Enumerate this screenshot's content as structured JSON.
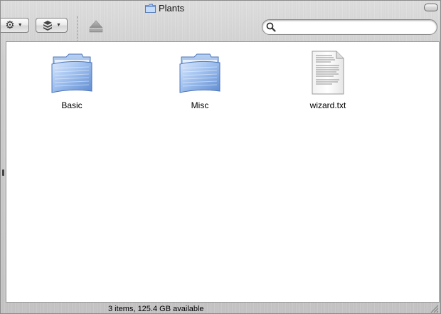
{
  "window": {
    "title": "Plants",
    "title_icon": "folder-icon"
  },
  "toolbar": {
    "action_icon": "gear-icon",
    "arrange_icon": "arrange-icon",
    "eject_icon": "eject-icon",
    "search": {
      "value": "",
      "placeholder": "",
      "icon": "magnifier-icon"
    }
  },
  "items": [
    {
      "label": "Basic",
      "icon": "folder-icon"
    },
    {
      "label": "Misc",
      "icon": "folder-icon"
    },
    {
      "label": "wizard.txt",
      "icon": "text-document-icon"
    }
  ],
  "status": {
    "text": "3 items, 125.4 GB available"
  },
  "colors": {
    "folder_blue": "#7fa7de",
    "content_bg": "#ffffff",
    "metal": "#cfcfcf"
  }
}
